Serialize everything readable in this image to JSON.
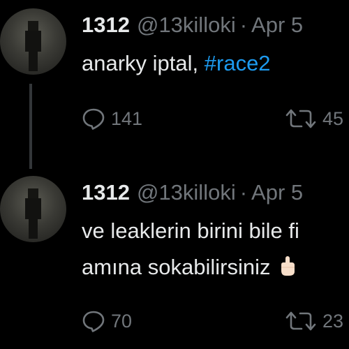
{
  "tweets": [
    {
      "name": "1312",
      "handle": "@13killoki",
      "separator": "·",
      "date": "Apr 5",
      "text_plain": "anarky iptal, ",
      "hashtag": "#race2",
      "reply_count": "141",
      "retweet_count": "45"
    },
    {
      "name": "1312",
      "handle": "@13killoki",
      "separator": "·",
      "date": "Apr 5",
      "line1": "ve leaklerin birini bile fi",
      "line2": "amına sokabilirsiniz",
      "emoji_icon": "middle-finger-emoji",
      "reply_count": "70",
      "retweet_count": "23"
    }
  ],
  "colors": {
    "background": "#000000",
    "text": "#e7e9ea",
    "muted": "#71767b",
    "link": "#1d9bf0",
    "thread_line": "#333639"
  }
}
